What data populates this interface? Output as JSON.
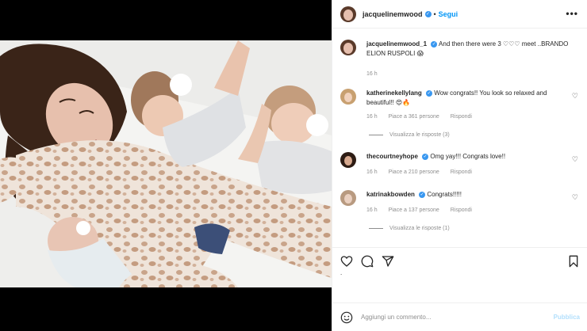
{
  "header": {
    "username": "jacquelinemwood",
    "separator": "•",
    "follow_label": "Segui",
    "more_label": "•••"
  },
  "caption": {
    "username": "jacquelinemwood_1",
    "text": "And then there were 3 ♡♡♡ meet ..BRANDO ELION RUSPOLI 😱",
    "time": "16 h"
  },
  "comments": [
    {
      "username": "katherinekellylang",
      "text": "Wow congrats!! You look so relaxed and beautiful!! 😍🔥",
      "time": "16 h",
      "likes": "Piace a 361 persone",
      "reply": "Rispondi",
      "view_replies": "Visualizza le risposte (3)"
    },
    {
      "username": "thecourtneyhope",
      "text": "Omg yay!!! Congrats love!!",
      "time": "16 h",
      "likes": "Piace a 210 persone",
      "reply": "Rispondi"
    },
    {
      "username": "katrinakbowden",
      "text": "Congrats!!!!!",
      "time": "16 h",
      "likes": "Piace a 137 persone",
      "reply": "Rispondi",
      "view_replies": "Visualizza le risposte (1)"
    }
  ],
  "likes_text": ".",
  "composer": {
    "placeholder": "Aggiungi un commento...",
    "publish_label": "Pubblica"
  },
  "icons": {
    "like": "heart-icon",
    "comment": "comment-icon",
    "share": "share-icon",
    "save": "bookmark-icon",
    "emoji": "emoji-icon",
    "verified": "verified-badge-icon"
  },
  "colors": {
    "accent": "#0095f6",
    "verified": "#3897f0",
    "muted": "#8e8e8e",
    "publish_disabled": "#b2dffc"
  }
}
